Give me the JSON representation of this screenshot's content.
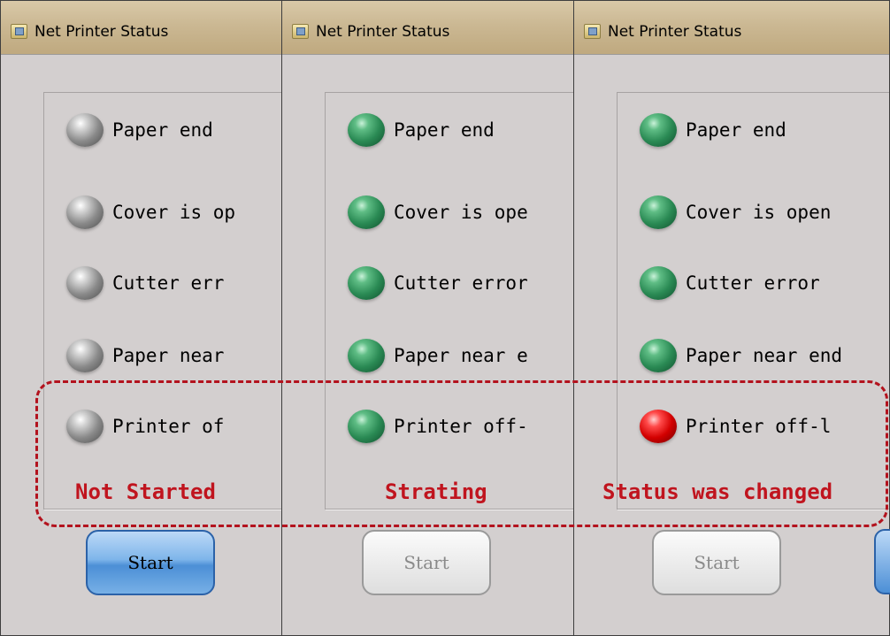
{
  "windows": [
    {
      "title": "Net Printer Status",
      "state_caption": "Not Started",
      "start_label": "Start",
      "start_enabled": true,
      "indicators": [
        {
          "label": "Paper end",
          "color": "grey"
        },
        {
          "label": "Cover is op",
          "color": "grey"
        },
        {
          "label": "Cutter err",
          "color": "grey"
        },
        {
          "label": "Paper near",
          "color": "grey"
        },
        {
          "label": "Printer of",
          "color": "grey"
        }
      ]
    },
    {
      "title": "Net Printer Status",
      "state_caption": "Strating",
      "start_label": "Start",
      "start_enabled": false,
      "indicators": [
        {
          "label": "Paper end",
          "color": "green"
        },
        {
          "label": "Cover is ope",
          "color": "green"
        },
        {
          "label": "Cutter error",
          "color": "green"
        },
        {
          "label": "Paper near e",
          "color": "green"
        },
        {
          "label": "Printer off-",
          "color": "green"
        }
      ]
    },
    {
      "title": "Net Printer Status",
      "state_caption": "Status was changed",
      "start_label": "Start",
      "start_enabled": false,
      "indicators": [
        {
          "label": "Paper end",
          "color": "green"
        },
        {
          "label": "Cover is open",
          "color": "green"
        },
        {
          "label": "Cutter error",
          "color": "green"
        },
        {
          "label": "Paper near end",
          "color": "green"
        },
        {
          "label": "Printer off-l",
          "color": "red"
        }
      ]
    }
  ],
  "colors": {
    "led_grey": "#8a8a8a",
    "led_green": "#2a8a54",
    "led_red": "#d30000",
    "caption_red": "#c0141e",
    "highlight_red": "#b3131e"
  }
}
